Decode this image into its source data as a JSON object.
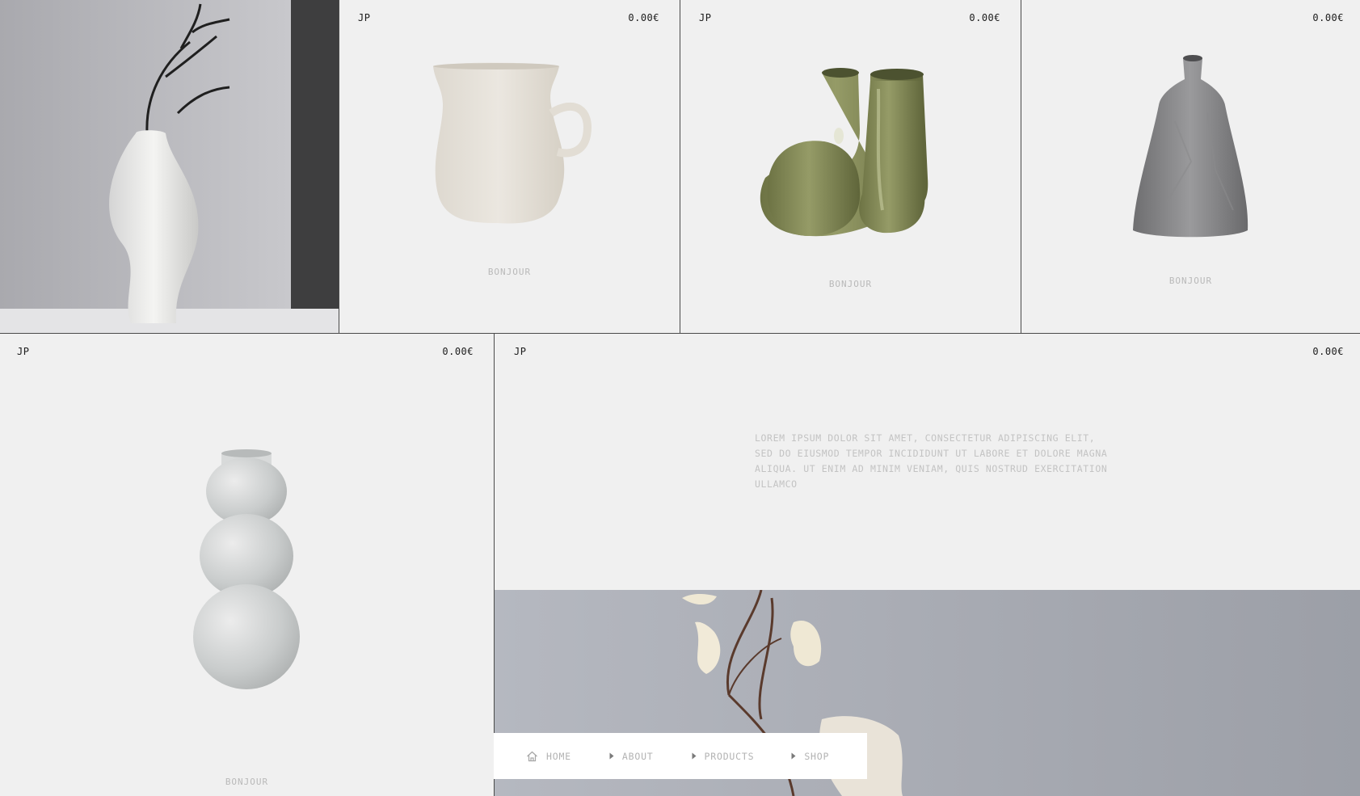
{
  "products": [
    {
      "brand": "JP",
      "price": "0.00€",
      "name": "BONJOUR"
    },
    {
      "brand": "JP",
      "price": "0.00€",
      "name": "BONJOUR"
    },
    {
      "brand": "",
      "price": "0.00€",
      "name": "BONJOUR"
    },
    {
      "brand": "JP",
      "price": "0.00€",
      "name": "BONJOUR"
    }
  ],
  "feature": {
    "brand": "JP",
    "price": "0.00€",
    "description": "LOREM IPSUM DOLOR SIT AMET, CONSECTETUR ADIPISCING ELIT, SED DO EIUSMOD TEMPOR INCIDIDUNT UT LABORE ET DOLORE MAGNA ALIQUA. UT ENIM AD MINIM VENIAM, QUIS NOSTRUD EXERCITATION ULLAMCO"
  },
  "nav": {
    "items": [
      {
        "label": "HOME",
        "icon": "home-icon"
      },
      {
        "label": "ABOUT",
        "icon": "triangle-right-icon"
      },
      {
        "label": "PRODUCTS",
        "icon": "triangle-right-icon"
      },
      {
        "label": "SHOP",
        "icon": "triangle-right-icon"
      }
    ]
  },
  "colors": {
    "background": "#f0f0f0",
    "divider": "#4a4a4a",
    "muted_text": "#b9b9b9",
    "olive_vase": "#7f8653"
  }
}
